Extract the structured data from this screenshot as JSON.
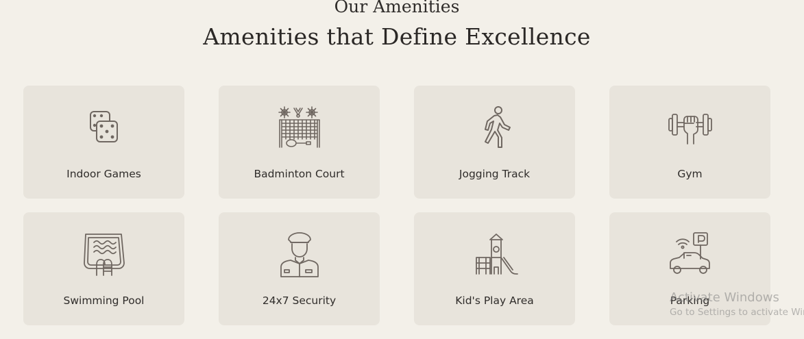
{
  "section": {
    "eyebrow": "Our Amenities",
    "heading": "Amenities that Define Excellence"
  },
  "amenities": [
    {
      "label": "Indoor Games",
      "icon": "dice-icon"
    },
    {
      "label": "Badminton Court",
      "icon": "badminton-net-icon"
    },
    {
      "label": "Jogging Track",
      "icon": "walking-person-icon"
    },
    {
      "label": "Gym",
      "icon": "dumbbell-fist-icon"
    },
    {
      "label": "Swimming Pool",
      "icon": "pool-ladder-icon"
    },
    {
      "label": "24x7 Security",
      "icon": "security-guard-icon"
    },
    {
      "label": "Kid's Play Area",
      "icon": "playground-slide-icon"
    },
    {
      "label": "Parking",
      "icon": "car-parking-icon"
    }
  ],
  "watermark": {
    "line1": "Activate Windows",
    "line2": "Go to Settings to activate Windows."
  },
  "colors": {
    "background": "#f3f0e9",
    "card": "#e8e4dc",
    "icon": "#6f6761",
    "text": "#2f2c2a"
  }
}
